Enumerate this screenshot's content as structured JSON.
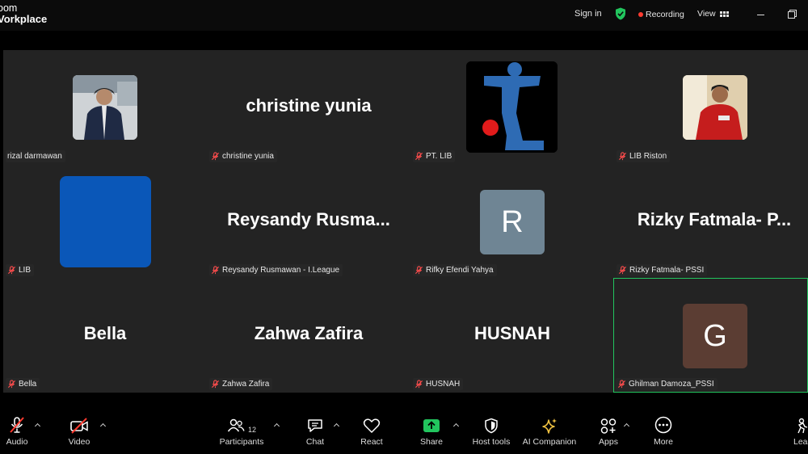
{
  "titlebar": {
    "logo_line1": "oom",
    "logo_line2": "Vorkplace",
    "signin_label": "Sign in",
    "recording_label": "Recording",
    "view_label": "View",
    "shield_color": "#22c55e",
    "recording_color": "#ff3b30"
  },
  "participants": [
    {
      "display": "",
      "avatar_kind": "photo-man-dark-jacket",
      "label": "rizal darmawan",
      "muted": false
    },
    {
      "display": "christine yunia",
      "avatar_kind": "none",
      "label": "christine yunia",
      "muted": true
    },
    {
      "display": "",
      "avatar_kind": "league-logo",
      "label": "PT. LIB",
      "muted": true
    },
    {
      "display": "",
      "avatar_kind": "photo-man-red-shirt",
      "label": "LIB Riston",
      "muted": true
    },
    {
      "display": "",
      "avatar_kind": "blue-square",
      "label": "LIB",
      "muted": true,
      "color": "#0a57b8"
    },
    {
      "display": "Reysandy  Rusma...",
      "avatar_kind": "none",
      "label": "Reysandy Rusmawan - I.League",
      "muted": true
    },
    {
      "display": "R",
      "avatar_kind": "letter",
      "label": "Rifky Efendi Yahya",
      "muted": true,
      "color": "#6f8594"
    },
    {
      "display": "Rizky  Fatmala-  P...",
      "avatar_kind": "none",
      "label": "Rizky Fatmala- PSSI",
      "muted": true
    },
    {
      "display": "Bella",
      "avatar_kind": "none",
      "label": "Bella",
      "muted": true
    },
    {
      "display": "Zahwa Zafira",
      "avatar_kind": "none",
      "label": "Zahwa Zafira",
      "muted": true
    },
    {
      "display": "HUSNAH",
      "avatar_kind": "none",
      "label": "HUSNAH",
      "muted": true
    },
    {
      "display": "G",
      "avatar_kind": "letter",
      "label": "Ghilman Damoza_PSSI",
      "muted": true,
      "color": "#5b3d33",
      "active_speaker": true
    }
  ],
  "toolbar": {
    "audio_label": "Audio",
    "video_label": "Video",
    "participants_label": "Participants",
    "participants_count": "12",
    "chat_label": "Chat",
    "react_label": "React",
    "share_label": "Share",
    "host_tools_label": "Host tools",
    "ai_companion_label": "AI Companion",
    "apps_label": "Apps",
    "more_label": "More",
    "leave_label": "Lea",
    "share_color": "#22c55e",
    "ai_color": "#f5c542"
  }
}
